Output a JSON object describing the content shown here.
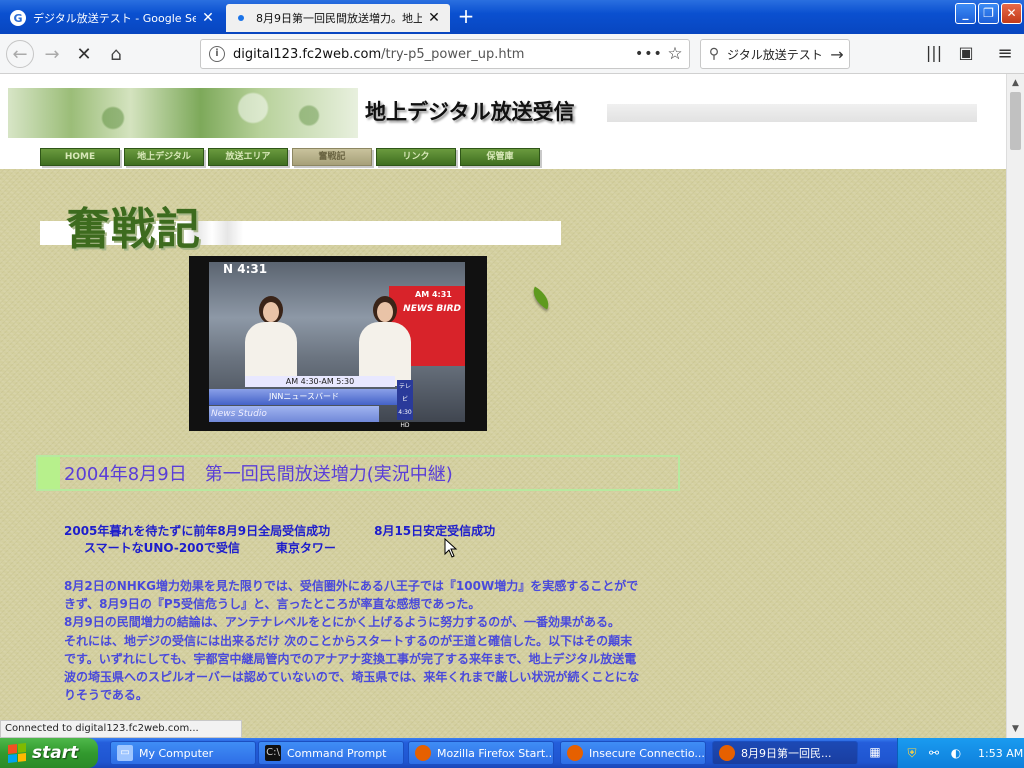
{
  "browser": {
    "tabs": [
      {
        "favicon": "G",
        "title": "デジタル放送テスト - Google Search",
        "active": false
      },
      {
        "favicon": "",
        "title": "8月9日第一回民間放送増力。地上",
        "active": true
      }
    ],
    "url_host": "digital123.fc2web.com",
    "url_path": "/try-p5_power_up.htm",
    "search_query": "ジタル放送テスト",
    "status_text": "Connected to digital123.fc2web.com..."
  },
  "site": {
    "title": "地上デジタル放送受信",
    "nav": [
      "HOME",
      "地上デジタル",
      "放送エリア",
      "奮戦記",
      "リンク",
      "保管庫"
    ],
    "nav_active_index": 3,
    "page_heading": "奮戦記",
    "tv": {
      "channel_logo": "N 4:31",
      "clock": "AM 4:31",
      "red_panel_text": "NEWS BIRD",
      "time_chyron": "AM 4:30-AM 5:30",
      "program_bar": "JNNニュースバード",
      "studio_bar": "News Studio",
      "side_chip": "テレビ 4:30 HD"
    },
    "section_title": "2004年8月9日　第一回民間放送増力(実況中継)",
    "subhead_line1_a": "2005年暮れを待たずに前年8月9日全局受信成功",
    "subhead_line1_b": "8月15日安定受信成功",
    "subhead_line2_a": "スマートなUNO-200で受信",
    "subhead_line2_b": "東京タワー",
    "body_paragraphs": [
      "8月2日のNHKG増力効果を見た限りでは、受信圏外にある八王子では『100W増力』を実感することができず、8月9日の『P5受信危うし』と、言ったところが率直な感想であった。",
      "8月9日の民間増力の結論は、アンテナレベルをとにかく上げるように努力するのが、一番効果がある。",
      "それには、地デジの受信には出来るだけ 次のことからスタートするのが王道と確信した。以下はその顛末です。いずれにしても、宇都宮中継局管内でのアナアナ変換工事が完了する来年まで、地上デジタル放送電波の埼玉県へのスピルオーバーは認めていないので、埼玉県では、来年くれまで厳しい状況が続くことになりそうである。"
    ]
  },
  "taskbar": {
    "start_label": "start",
    "buttons": [
      {
        "label": "My Computer",
        "icon": "computer-icon"
      },
      {
        "label": "Command Prompt",
        "icon": "cmd-icon"
      },
      {
        "label": "Mozilla Firefox Start...",
        "icon": "firefox-icon"
      },
      {
        "label": "Insecure Connectio...",
        "icon": "firefox-icon"
      },
      {
        "label": "8月9日第一回民...",
        "icon": "firefox-icon",
        "active": true
      }
    ],
    "clock": "1:53 AM"
  },
  "colors": {
    "xp_blue": "#245edb",
    "start_green": "#329a2e",
    "paper": "#d3cf9e",
    "heading_green": "#3d6b1e",
    "section_text": "#5a3ed8",
    "body_text": "#4a4adb"
  }
}
